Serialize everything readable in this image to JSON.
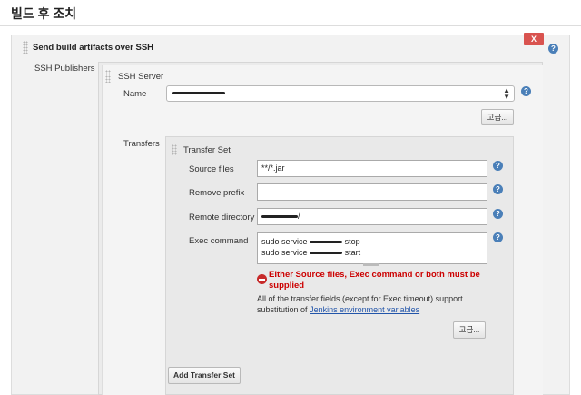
{
  "page_title": "빌드 후 조치",
  "publisher": {
    "section_title": "Send build artifacts over SSH",
    "delete_label": "X",
    "publishers_label": "SSH Publishers"
  },
  "server": {
    "section_title": "SSH Server",
    "name_label": "Name",
    "advanced_label": "고급..."
  },
  "transfers": {
    "label": "Transfers",
    "section_title": "Transfer Set",
    "source_files_label": "Source files",
    "source_files_value": "**/*.jar",
    "remove_prefix_label": "Remove prefix",
    "remove_prefix_value": "",
    "remote_directory_label": "Remote directory",
    "remote_directory_suffix": "/",
    "exec_command_label": "Exec command",
    "exec_line1_prefix": "sudo service",
    "exec_line1_suffix": "stop",
    "exec_line2_prefix": "sudo service",
    "exec_line2_suffix": "start",
    "error_message": "Either Source files, Exec command or both must be supplied",
    "info_prefix": "All of the transfer fields (except for Exec timeout) support substitution of",
    "info_link": "Jenkins environment variables",
    "advanced_label": "고급...",
    "add_label": "Add Transfer Set"
  },
  "icons": {
    "help": "help-icon",
    "error": "error-icon",
    "drag": "drag-handle-icon",
    "chevron": "chevron-updown-icon"
  },
  "colors": {
    "delete_button": "#d9534f",
    "error_text": "#cc0000",
    "help_icon": "#4a7fb8",
    "link": "#2255aa"
  }
}
